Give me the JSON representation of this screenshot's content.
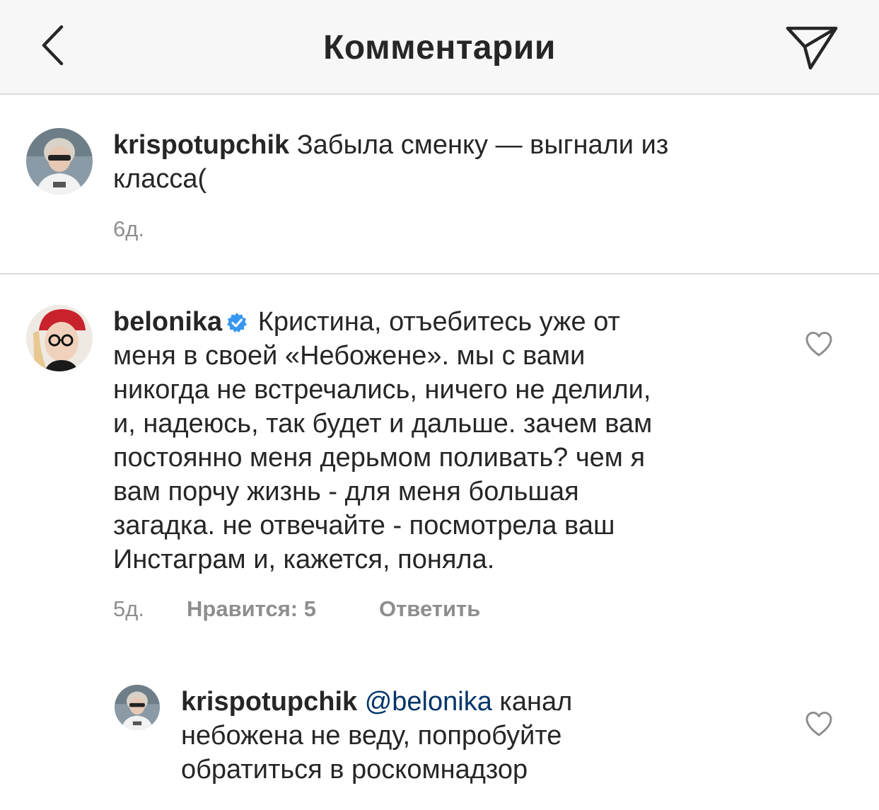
{
  "header": {
    "title": "Комментарии",
    "back_icon": "chevron-left-icon",
    "send_icon": "paper-plane-icon"
  },
  "caption": {
    "username": "krispotupchik",
    "text_line1": "Забыла сменку — выгнали из",
    "text_line2": "класса(",
    "time": "6д."
  },
  "comment": {
    "username": "belonika",
    "verified": true,
    "text_line1": "Кристина, отъебитесь уже от",
    "lines": [
      "меня в своей «Небожене». мы с вами",
      "никогда не встречались, ничего не делили,",
      "и, надеюсь, так будет и дальше. зачем вам",
      "постоянно меня дерьмом поливать? чем я",
      "вам порчу жизнь - для меня большая",
      "загадка. не отвечайте - посмотрела ваш",
      "Инстаграм и, кажется, поняла."
    ],
    "time": "5д.",
    "likes": "Нравится: 5",
    "reply": "Ответить"
  },
  "reply": {
    "username": "krispotupchik",
    "mention": "@belonika",
    "text_line1_rest": " канал",
    "text_line2": "небожена не веду, попробуйте",
    "text_line3": "обратиться в роскомнадзор"
  },
  "colors": {
    "header_bg": "#f7f7f7",
    "text": "#262626",
    "meta": "#8e8e8e",
    "mention": "#003569",
    "verified": "#3897f0",
    "divider": "#dbdbdb"
  }
}
